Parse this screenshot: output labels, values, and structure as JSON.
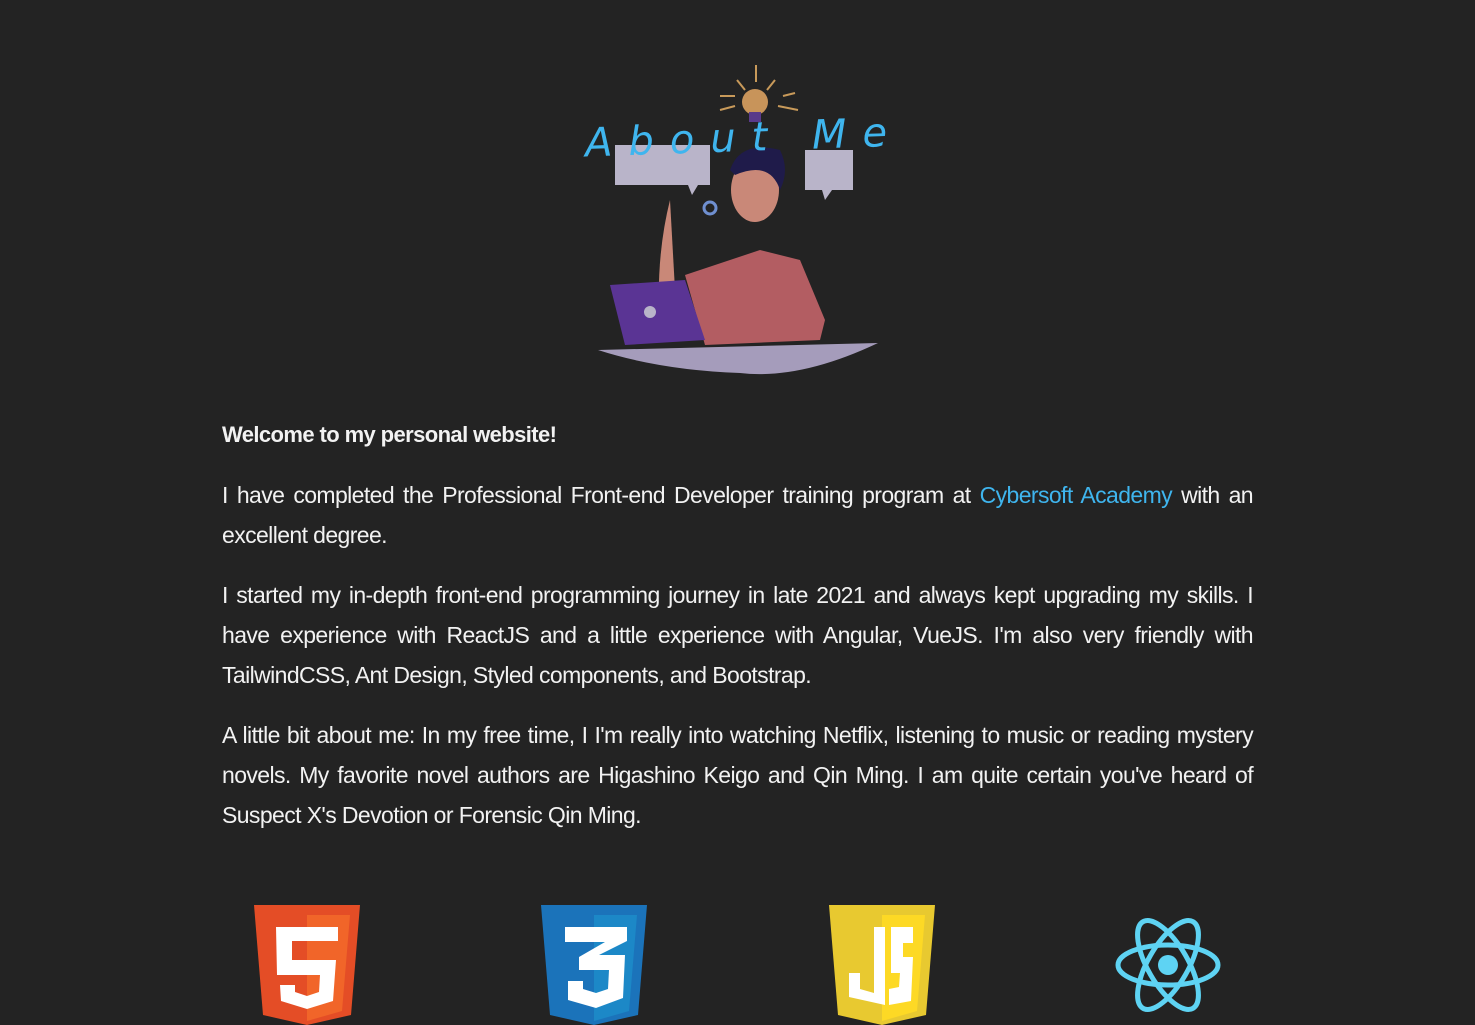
{
  "hero": {
    "title": "About Me"
  },
  "intro": {
    "welcome": "Welcome to my personal website!",
    "p1_before": "I have completed the Professional Front-end Developer training program at ",
    "p1_link": "Cybersoft Academy",
    "p1_after": " with an excellent degree.",
    "p2": "I started my in-depth front-end programming journey in late 2021 and always kept upgrading my skills. I have experience with ReactJS and a little experience with Angular, VueJS. I'm also very friendly with TailwindCSS, Ant Design, Styled components, and Bootstrap.",
    "p3": "A little bit about me: In my free time, I I'm really into watching Netflix, listening to music or reading mystery novels. My favorite novel authors are Higashino Keigo and Qin Ming. I am quite certain you've heard of Suspect X's Devotion or Forensic Qin Ming."
  },
  "skills": [
    {
      "icon": "html5-icon",
      "color": "#e44d26"
    },
    {
      "icon": "css3-icon",
      "color": "#1b73ba"
    },
    {
      "icon": "javascript-icon",
      "color": "#e8c930"
    },
    {
      "icon": "react-icon",
      "color": "#5ed3f3"
    }
  ],
  "colors": {
    "background": "#232323",
    "accent": "#3fb5ee",
    "text": "#f2f2f2"
  }
}
